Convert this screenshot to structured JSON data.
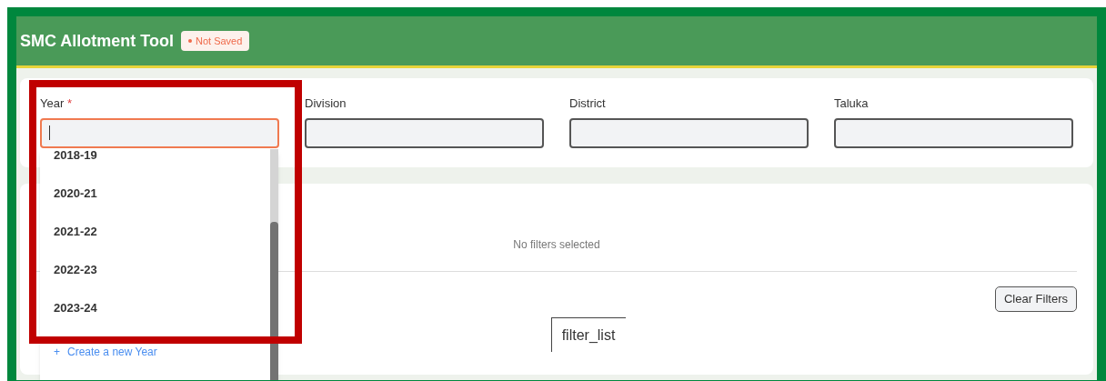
{
  "header": {
    "title": "SMC Allotment Tool",
    "status_badge": "Not Saved"
  },
  "filters": [
    {
      "label": "Year",
      "required_mark": "*",
      "focused": true,
      "expanded": true
    },
    {
      "label": "Division",
      "focused": false,
      "expanded": false
    },
    {
      "label": "District",
      "focused": false,
      "expanded": false
    },
    {
      "label": "Taluka",
      "focused": false,
      "expanded": false
    }
  ],
  "dropdown": {
    "options": [
      {
        "label": "2018-19",
        "selected": false
      },
      {
        "label": "2020-21",
        "selected": false
      },
      {
        "label": "2021-22",
        "selected": false
      },
      {
        "label": "2022-23",
        "selected": false
      },
      {
        "label": "2023-24",
        "selected": false
      }
    ],
    "create_option": {
      "icon": "+",
      "label": "Create a new Year"
    }
  },
  "results": {
    "empty_message": "No filters selected",
    "clear_button": "Clear Filters",
    "filter_toggle": "filter_list"
  }
}
